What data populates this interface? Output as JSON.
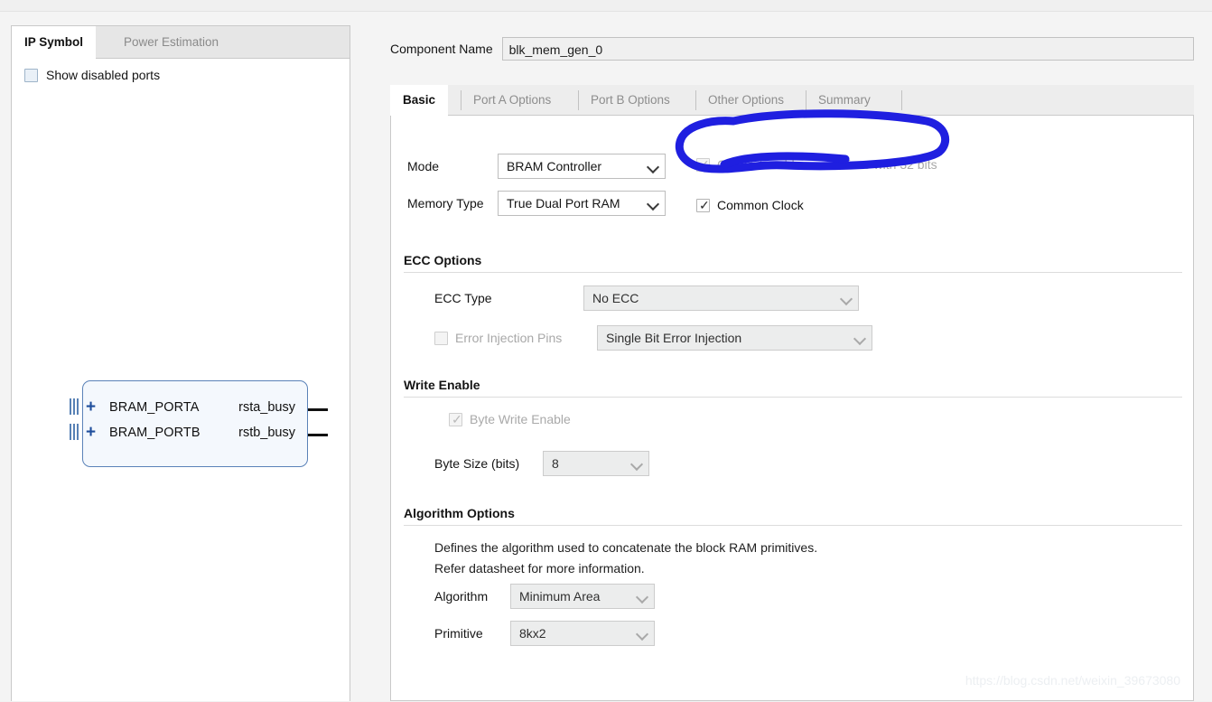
{
  "left_panel": {
    "tabs": [
      {
        "label": "IP Symbol",
        "active": true
      },
      {
        "label": "Power Estimation",
        "active": false
      }
    ],
    "show_disabled_ports": {
      "label": "Show disabled ports",
      "checked": false
    },
    "symbol": {
      "input_ports": [
        {
          "name": "BRAM_PORTA",
          "expander": "+"
        },
        {
          "name": "BRAM_PORTB",
          "expander": "+"
        }
      ],
      "output_ports": [
        {
          "name": "rsta_busy"
        },
        {
          "name": "rstb_busy"
        }
      ]
    }
  },
  "header": {
    "component_name_label": "Component Name",
    "component_name_value": "blk_mem_gen_0"
  },
  "tabs": [
    {
      "label": "Basic",
      "active": true
    },
    {
      "label": "Port A Options",
      "active": false
    },
    {
      "label": "Port B Options",
      "active": false
    },
    {
      "label": "Other Options",
      "active": false
    },
    {
      "label": "Summary",
      "active": false
    }
  ],
  "basic": {
    "mode": {
      "label": "Mode",
      "value": "BRAM Controller"
    },
    "memory_type": {
      "label": "Memory Type",
      "value": "True Dual Port RAM"
    },
    "generate_address_interface": {
      "label": "Generate address interface with 32 bits",
      "checked": true,
      "disabled": true
    },
    "common_clock": {
      "label": "Common Clock",
      "checked": true,
      "disabled": false
    }
  },
  "ecc_options": {
    "title": "ECC Options",
    "ecc_type": {
      "label": "ECC Type",
      "value": "No ECC"
    },
    "error_injection_pins": {
      "label": "Error Injection Pins",
      "checked": false,
      "disabled": true,
      "value": "Single Bit Error Injection"
    }
  },
  "write_enable": {
    "title": "Write Enable",
    "byte_write_enable": {
      "label": "Byte Write Enable",
      "checked": true,
      "disabled": true
    },
    "byte_size": {
      "label": "Byte Size (bits)",
      "value": "8"
    }
  },
  "algorithm_options": {
    "title": "Algorithm Options",
    "description_line1": "Defines the algorithm used to concatenate the block RAM primitives.",
    "description_line2": "Refer datasheet for more information.",
    "algorithm": {
      "label": "Algorithm",
      "value": "Minimum Area"
    },
    "primitive": {
      "label": "Primitive",
      "value": "8kx2"
    }
  },
  "annotation": {
    "type": "hand-drawn-ellipse",
    "color": "#1f1fe0",
    "target": "Generate address interface with 32 bits"
  },
  "watermark": "https://blog.csdn.net/weixin_39673080"
}
